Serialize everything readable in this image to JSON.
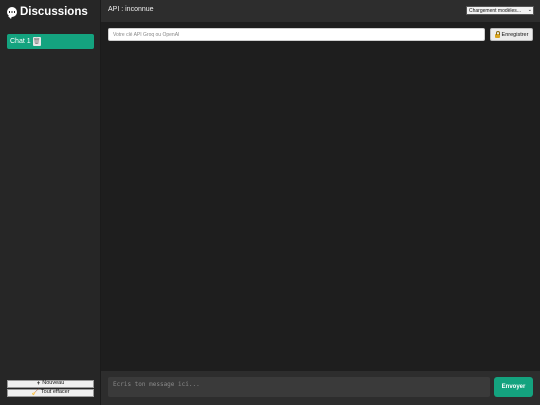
{
  "sidebar": {
    "title": "Discussions",
    "chats": [
      {
        "label": "Chat 1",
        "delete_icon": "trash-icon"
      }
    ],
    "new_label": "Nouveau",
    "clear_label": "Tout effacer"
  },
  "topbar": {
    "api_status": "API : inconnue",
    "model_select": "Chargement modèles..."
  },
  "settings": {
    "api_key_placeholder": "Votre clé API Groq ou OpenAI",
    "save_label": "Enregistrer"
  },
  "composer": {
    "placeholder": "Ecris ton message ici...",
    "send_label": "Envoyer"
  },
  "colors": {
    "accent": "#14a37f",
    "background": "#202020",
    "sidebar": "#262626"
  }
}
